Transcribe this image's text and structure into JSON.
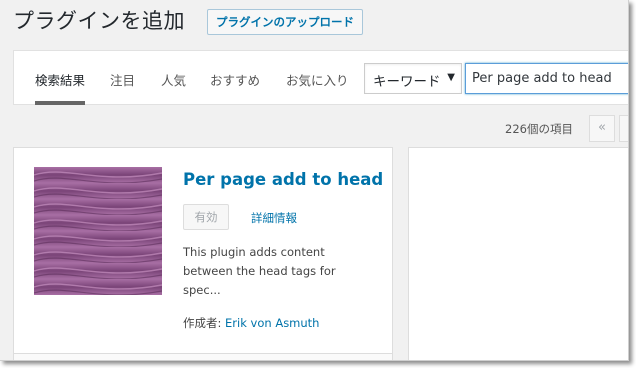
{
  "header": {
    "title": "プラグインを追加",
    "upload_button": "プラグインのアップロード"
  },
  "filter": {
    "tabs": [
      {
        "label": "検索結果",
        "current": true
      },
      {
        "label": "注目",
        "current": false
      },
      {
        "label": "人気",
        "current": false
      },
      {
        "label": "おすすめ",
        "current": false
      },
      {
        "label": "お気に入り",
        "current": false
      }
    ],
    "search_type": {
      "selected": "キーワード",
      "caret": "▼"
    },
    "search": {
      "value": "Per page add to head"
    }
  },
  "pagination": {
    "count_text": "226個の項目",
    "first_label": "«",
    "prev_label": "‹"
  },
  "plugin_card": {
    "name": "Per page add to head",
    "activate_label": "有効",
    "details_label": "詳細情報",
    "description": "This plugin adds content between the head tags for spec...",
    "author_label": "作成者:",
    "author_name": "Erik von Asmuth",
    "icon": "wave-pattern-icon",
    "icon_colors": [
      "#7a4478",
      "#a86fa4"
    ]
  },
  "colors": {
    "accent": "#0073aa",
    "background": "#f1f1f1"
  }
}
